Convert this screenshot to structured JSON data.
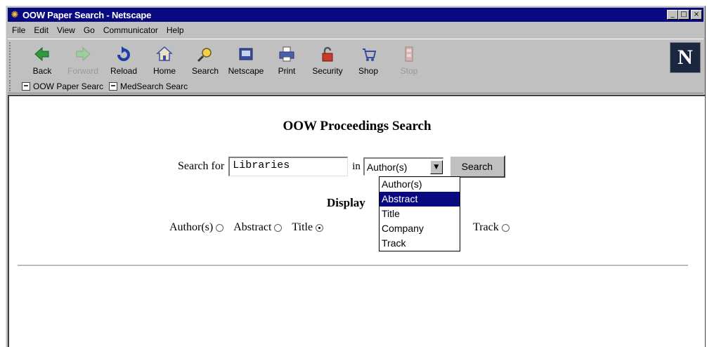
{
  "window": {
    "title": "OOW Paper Search - Netscape",
    "controls": {
      "minimize": "_",
      "maximize": "□",
      "close": "×"
    }
  },
  "menu": [
    "File",
    "Edit",
    "View",
    "Go",
    "Communicator",
    "Help"
  ],
  "toolbar": {
    "buttons": [
      {
        "label": "Back",
        "icon": "back-arrow-icon"
      },
      {
        "label": "Forward",
        "icon": "forward-arrow-icon",
        "disabled": true
      },
      {
        "label": "Reload",
        "icon": "reload-icon"
      },
      {
        "label": "Home",
        "icon": "home-icon"
      },
      {
        "label": "Search",
        "icon": "search-icon"
      },
      {
        "label": "Netscape",
        "icon": "netscape-icon"
      },
      {
        "label": "Print",
        "icon": "print-icon"
      },
      {
        "label": "Security",
        "icon": "lock-icon"
      },
      {
        "label": "Shop",
        "icon": "shop-icon"
      },
      {
        "label": "Stop",
        "icon": "stop-icon",
        "disabled": true
      }
    ],
    "logo": "N"
  },
  "bookmarks": [
    "OOW Paper Searc",
    "MedSearch Searc"
  ],
  "page": {
    "title": "OOW Proceedings Search",
    "search_for_label": "Search for",
    "search_value": "Libraries",
    "in_label": "in",
    "select_value": "Author(s)",
    "search_button": "Search",
    "dropdown_options": [
      "Author(s)",
      "Abstract",
      "Title",
      "Company",
      "Track"
    ],
    "dropdown_highlighted": "Abstract",
    "display_label": "Display",
    "display_options": [
      {
        "label": "Author(s)",
        "checked": false
      },
      {
        "label": "Abstract",
        "checked": false
      },
      {
        "label": "Title",
        "checked": true
      },
      {
        "label": "Track",
        "checked": false
      }
    ]
  },
  "colors": {
    "titlebar": "#0a0a80",
    "chrome": "#c0c0c0",
    "selection": "#0a0a80"
  }
}
